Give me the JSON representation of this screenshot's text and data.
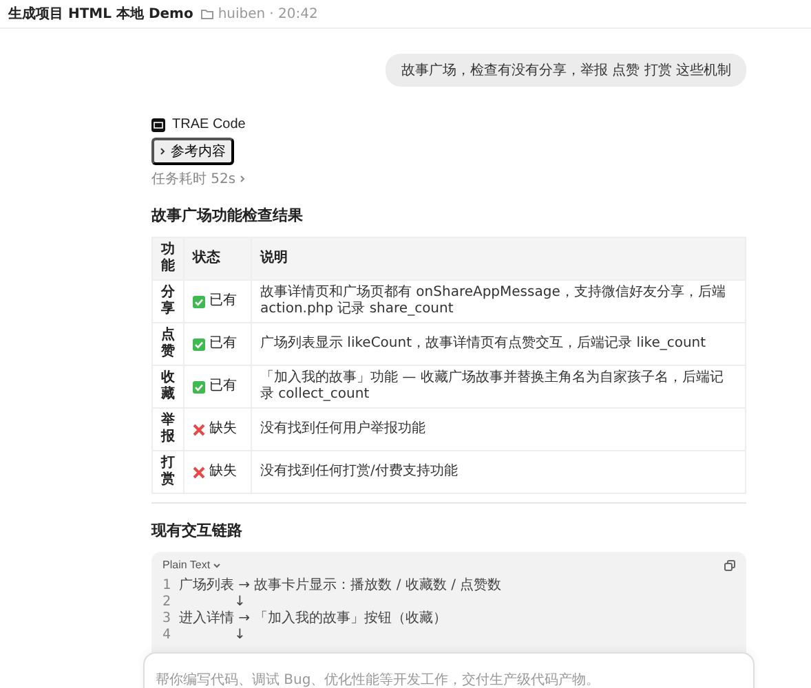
{
  "header": {
    "title": "生成项目 HTML 本地 Demo",
    "folder": "huiben",
    "time": "· 20:42"
  },
  "user_message": "故事广场，检查有没有分享，举报 点赞 打赏 这些机制",
  "assistant": {
    "name": "TRAE Code",
    "reference_chip": "参考内容",
    "duration": "任务耗时 52s"
  },
  "section1": {
    "heading": "故事广场功能检查结果",
    "table": {
      "columns": [
        "功能",
        "状态",
        "说明"
      ],
      "rows": [
        {
          "feature": "分享",
          "present": true,
          "status": "已有",
          "description": "故事详情页和广场页都有 onShareAppMessage，支持微信好友分享，后端 action.php 记录 share_count"
        },
        {
          "feature": "点赞",
          "present": true,
          "status": "已有",
          "description": "广场列表显示 likeCount，故事详情页有点赞交互，后端记录 like_count"
        },
        {
          "feature": "收藏",
          "present": true,
          "status": "已有",
          "description": "「加入我的故事」功能 — 收藏广场故事并替换主角名为自家孩子名，后端记录 collect_count"
        },
        {
          "feature": "举报",
          "present": false,
          "status": "缺失",
          "description": "没有找到任何用户举报功能"
        },
        {
          "feature": "打赏",
          "present": false,
          "status": "缺失",
          "description": "没有找到任何打赏/付费支持功能"
        }
      ]
    }
  },
  "section2": {
    "heading": "现有交互链路",
    "code_block": {
      "language": "Plain Text",
      "lines": [
        {
          "number": "1",
          "kind": "text",
          "text": "广场列表 → 故事卡片显示：播放数 / 收藏数 / 点赞数"
        },
        {
          "number": "2",
          "kind": "arrow",
          "text": "↓"
        },
        {
          "number": "3",
          "kind": "text",
          "text": "进入详情 → 「加入我的故事」按钮（收藏）"
        },
        {
          "number": "4",
          "kind": "arrow",
          "text": "↓"
        }
      ]
    }
  },
  "input": {
    "placeholder": "帮你编写代码、调试 Bug、优化性能等开发工作，交付生产级代码产物。"
  }
}
